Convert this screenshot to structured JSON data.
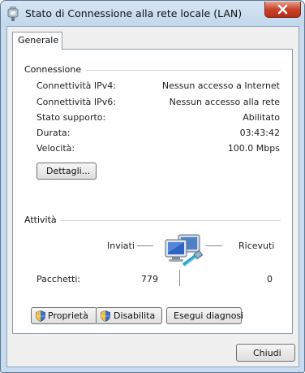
{
  "window": {
    "title": "Stato di Connessione alla rete locale (LAN)"
  },
  "tabs": [
    {
      "label": "Generale",
      "selected": true
    }
  ],
  "connection": {
    "group_label": "Connessione",
    "rows": [
      {
        "label": "Connettività IPv4:",
        "value": "Nessun accesso a Internet"
      },
      {
        "label": "Connettività IPv6:",
        "value": "Nessun accesso alla rete"
      },
      {
        "label": "Stato supporto:",
        "value": "Abilitato"
      },
      {
        "label": "Durata:",
        "value": "03:43:42"
      },
      {
        "label": "Velocità:",
        "value": "100.0 Mbps"
      }
    ],
    "details_button": "Dettagli..."
  },
  "activity": {
    "group_label": "Attività",
    "sent_label": "Inviati",
    "received_label": "Ricevuti",
    "packets_label": "Pacchetti:",
    "packets_sent": "779",
    "packets_received": "0"
  },
  "buttons": {
    "properties": "Proprietà",
    "disable": "Disabilita",
    "diagnose": "Esegui diagnosi",
    "close": "Chiudi"
  },
  "icons": {
    "title": "network-adapter-icon",
    "close": "close-icon",
    "shield": "uac-shield-icon",
    "activity": "network-computers-icon"
  },
  "colors": {
    "title_bar": "#c9dcef",
    "close_button": "#c7432a",
    "panel": "#ffffff",
    "dialog": "#f0f0f0"
  }
}
